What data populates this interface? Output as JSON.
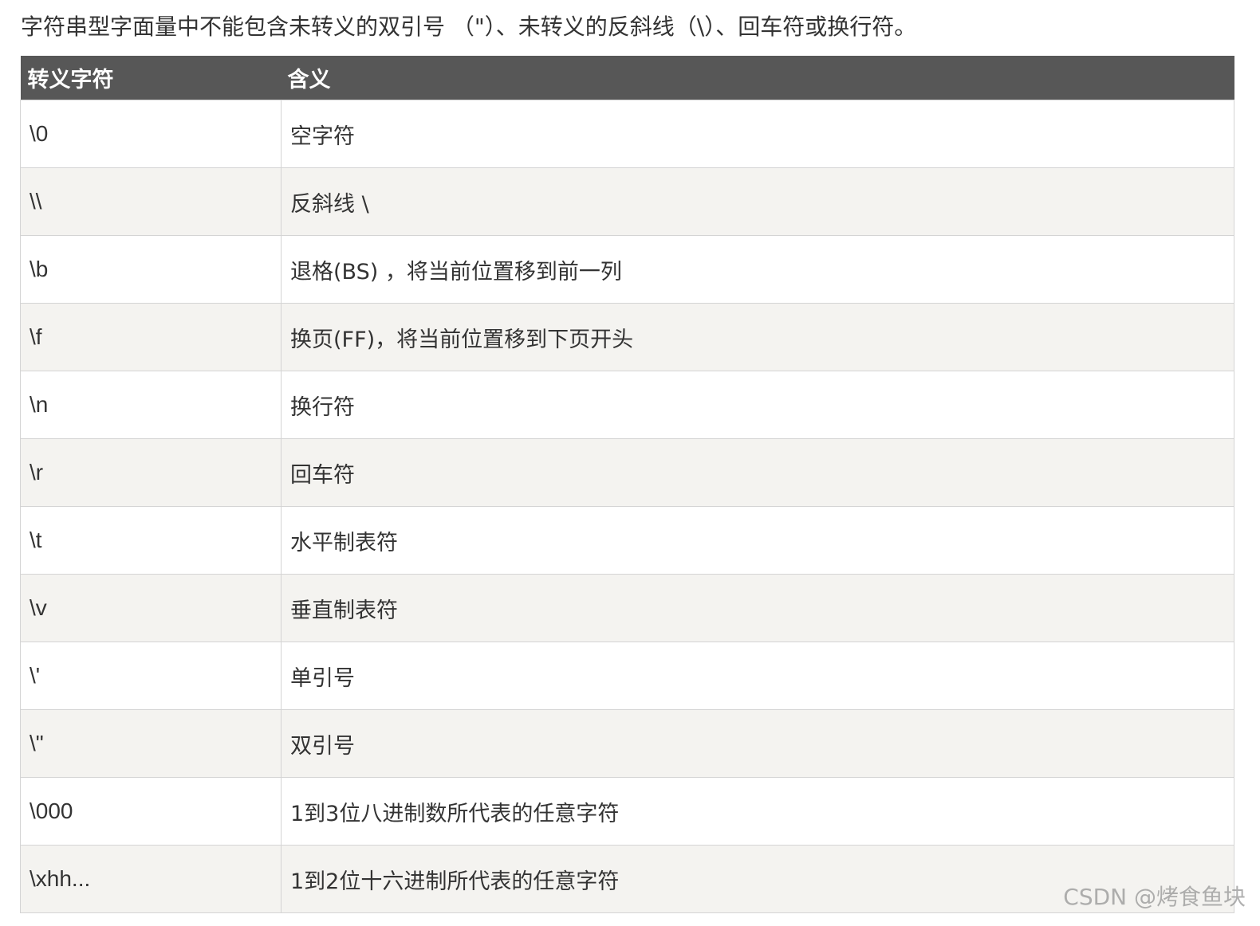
{
  "intro": "字符串型字面量中不能包含未转义的双引号 （\"）、未转义的反斜线（\\）、回车符或换行符。",
  "table": {
    "headers": [
      "转义字符",
      "含义"
    ],
    "rows": [
      {
        "code": "\\0",
        "meaning": "空字符"
      },
      {
        "code": "\\\\",
        "meaning": "反斜线 \\"
      },
      {
        "code": "\\b",
        "meaning": "退格(BS) ，将当前位置移到前一列"
      },
      {
        "code": "\\f",
        "meaning": "换页(FF)，将当前位置移到下页开头"
      },
      {
        "code": "\\n",
        "meaning": "换行符"
      },
      {
        "code": "\\r",
        "meaning": "回车符"
      },
      {
        "code": "\\t",
        "meaning": "水平制表符"
      },
      {
        "code": "\\v",
        "meaning": "垂直制表符"
      },
      {
        "code": "\\'",
        "meaning": "单引号"
      },
      {
        "code": "\\\"",
        "meaning": "双引号"
      },
      {
        "code": "\\000",
        "meaning": "1到3位八进制数所代表的任意字符"
      },
      {
        "code": "\\xhh...",
        "meaning": "1到2位十六进制所代表的任意字符"
      }
    ]
  },
  "watermark": "CSDN @烤食鱼块"
}
